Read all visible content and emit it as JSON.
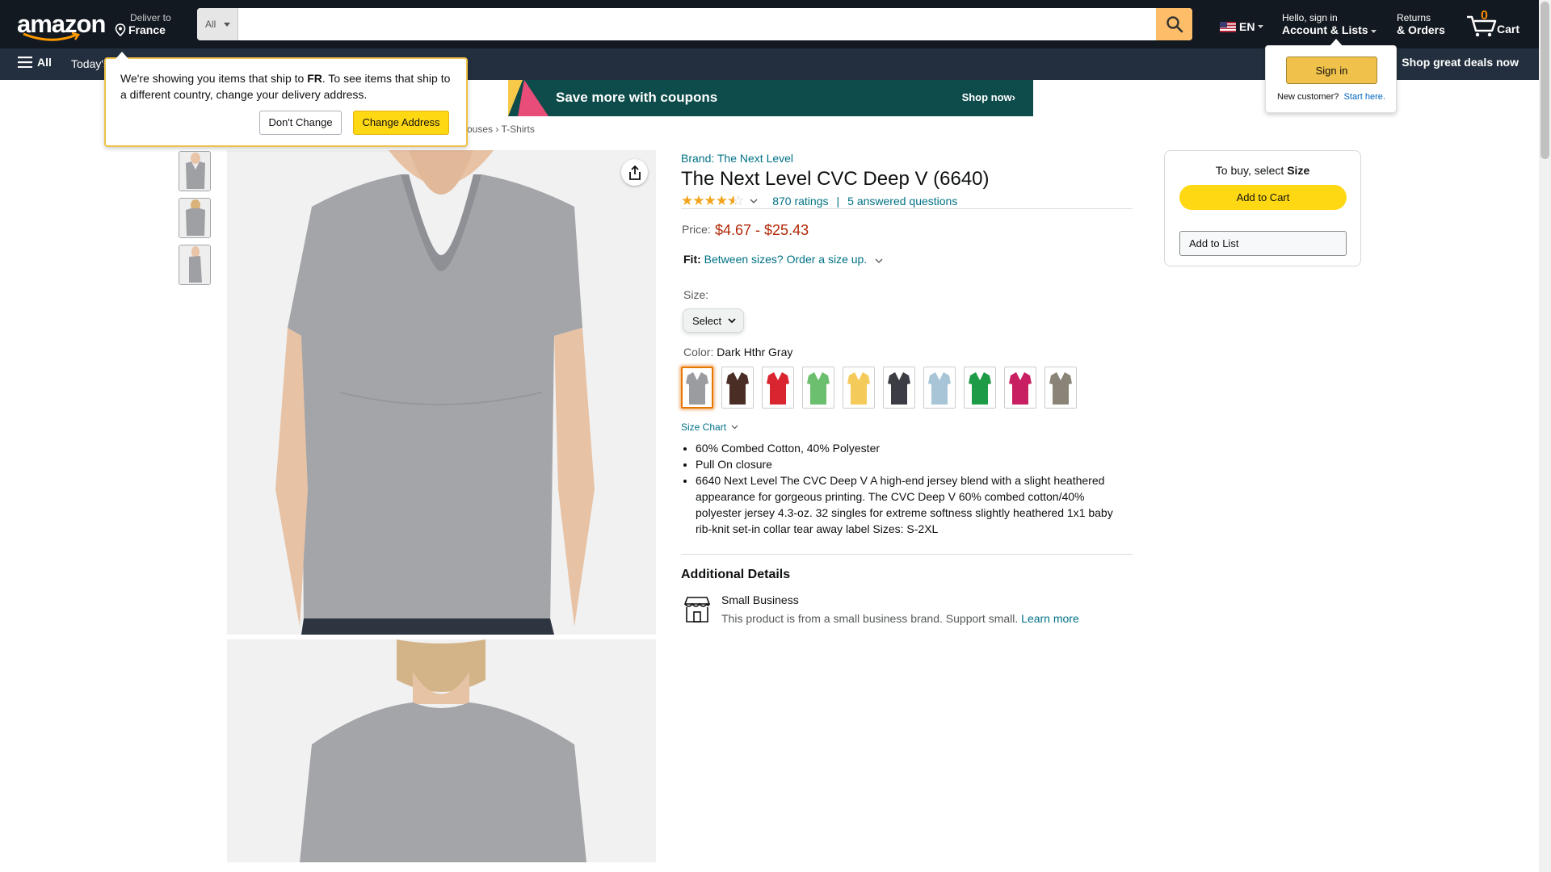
{
  "header": {
    "logo": "amazon",
    "deliver_small": "Deliver to",
    "deliver_country": "France",
    "search_category": "All",
    "search_placeholder": "",
    "lang": "EN",
    "account_small": "Hello, sign in",
    "account_big": "Account & Lists",
    "returns_small": "Returns",
    "returns_big": "& Orders",
    "cart_count": "0",
    "cart_label": "Cart"
  },
  "subnav": {
    "all_label": "All",
    "today": "Today's",
    "deals": "Shop great deals now"
  },
  "ship_popup": {
    "text_pre": "We're showing you items that ship to ",
    "country_code": "FR",
    "text_post": ". To see items that ship to a different country, change your delivery address.",
    "dont_change": "Don't Change",
    "change_address": "Change Address"
  },
  "signin_popup": {
    "button": "Sign in",
    "new_customer": "New customer?",
    "start_here": "Start here."
  },
  "coupon_banner": {
    "text": "Save more with coupons",
    "cta": "Shop now›"
  },
  "breadcrumb": {
    "items": [
      "ouses",
      "T-Shirts"
    ],
    "separator": "›"
  },
  "product": {
    "brand": "Brand: The Next Level",
    "title": "The Next Level CVC Deep V (6640)",
    "rating_stars": 4.5,
    "ratings": "870 ratings",
    "separator": "|",
    "questions": "5 answered questions",
    "price_label": "Price:",
    "price": "$4.67 - $25.43",
    "fit_label": "Fit:",
    "fit_text": "Between sizes? Order a size up.",
    "size_label": "Size:",
    "size_select": "Select",
    "color_label": "Color:",
    "color_value": "Dark Hthr Gray",
    "swatch_colors": [
      "#9a9ca0",
      "#4a2e26",
      "#d9252f",
      "#6bbf6e",
      "#f4cb5a",
      "#3b3c44",
      "#a7c5d6",
      "#1e9b47",
      "#c81f63",
      "#8a8478"
    ],
    "size_chart": "Size Chart",
    "bullets": [
      "60% Combed Cotton, 40% Polyester",
      "Pull On closure",
      "6640 Next Level The CVC Deep V A high-end jersey blend with a slight heathered appearance for gorgeous printing. The CVC Deep V 60% combed cotton/40% polyester jersey 4.3-oz. 32 singles for extreme softness slightly heathered 1x1 baby rib-knit set-in collar tear away label Sizes: S-2XL"
    ],
    "additional_details": "Additional Details",
    "small_business_title": "Small Business",
    "small_business_desc": "This product is from a small business brand. Support small.",
    "learn_more": "Learn more"
  },
  "buybox": {
    "to_buy_pre": "To buy, select ",
    "to_buy_bold": "Size",
    "add_to_cart": "Add to Cart",
    "add_to_list": "Add to List"
  },
  "colors": {
    "nav_dark": "#131921",
    "nav_sub": "#232f3e",
    "search_button": "#febd69",
    "price": "#b12704",
    "link": "#007185",
    "add_to_cart": "#ffd814"
  }
}
